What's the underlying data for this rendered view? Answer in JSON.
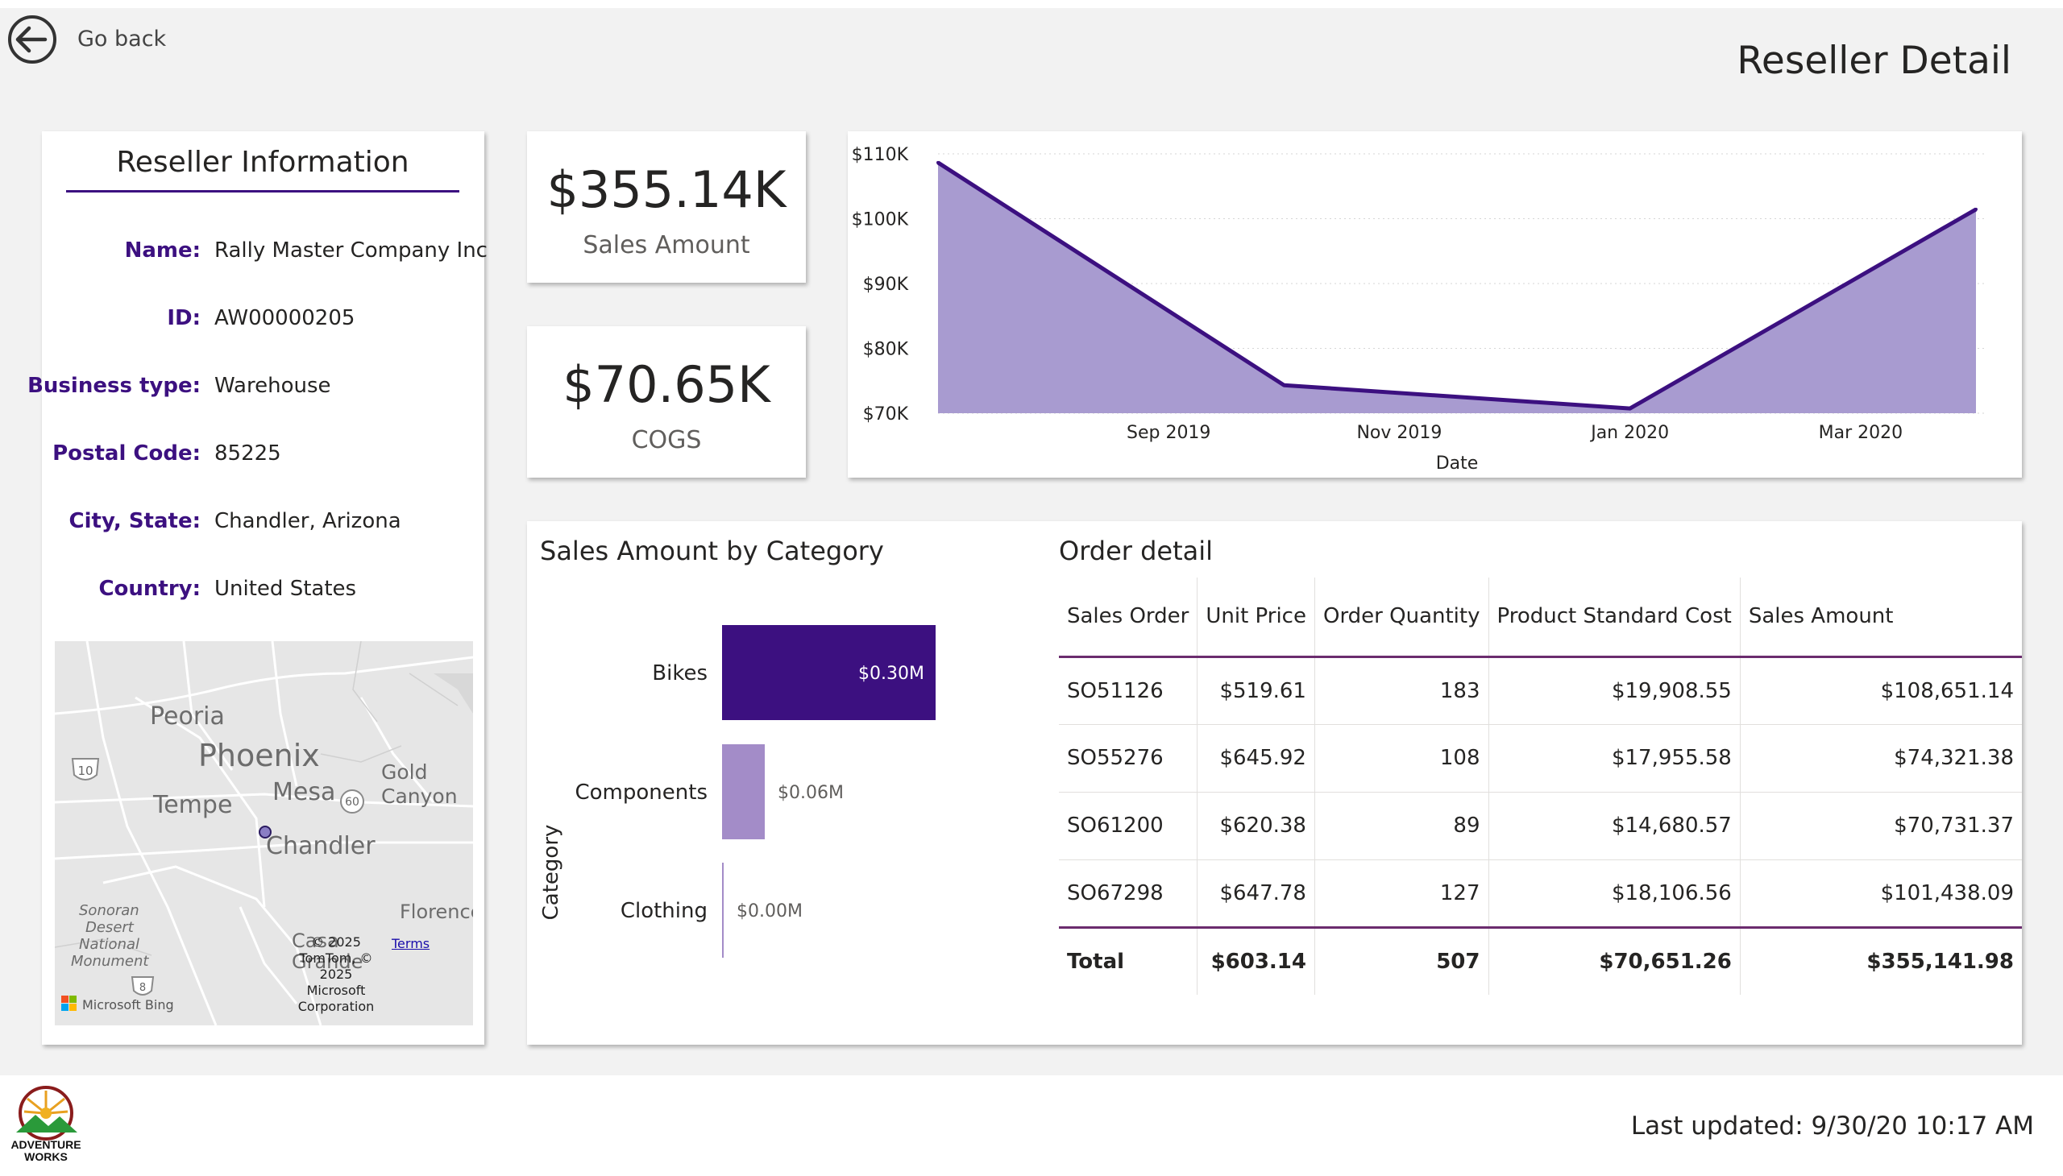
{
  "header": {
    "back_label": "Go back",
    "page_title": "Reseller Detail"
  },
  "reseller": {
    "title": "Reseller Information",
    "fields": [
      {
        "label": "Name:",
        "value": "Rally Master Company Inc"
      },
      {
        "label": "ID:",
        "value": "AW00000205"
      },
      {
        "label": "Business type:",
        "value": "Warehouse"
      },
      {
        "label": "Postal Code:",
        "value": "85225"
      },
      {
        "label": "City, State:",
        "value": "Chandler, Arizona"
      },
      {
        "label": "Country:",
        "value": "United States"
      }
    ],
    "map": {
      "places": [
        "Peoria",
        "Phoenix",
        "Gold",
        "Canyon",
        "Tempe",
        "Mesa",
        "Chandler",
        "Florence",
        "Casa",
        "Grande",
        "Sonoran",
        "Desert",
        "National",
        "Monument"
      ],
      "shields": [
        "10",
        "60",
        "8"
      ],
      "provider": "Microsoft Bing",
      "copyright": "© 2025 TomTom, © 2025 Microsoft Corporation",
      "copyright_lines": [
        "© 2025",
        "TomTom, ©",
        "2025",
        "Microsoft",
        "Corporation"
      ],
      "terms_link": "Terms"
    }
  },
  "kpis": [
    {
      "value": "$355.14K",
      "label": "Sales Amount"
    },
    {
      "value": "$70.65K",
      "label": "COGS"
    }
  ],
  "chart_data": [
    {
      "type": "area",
      "title": "",
      "xlabel": "Date",
      "ylabel": "",
      "x": [
        "2019-07",
        "2019-10",
        "2020-01",
        "2020-04"
      ],
      "x_tick_labels": [
        "Sep 2019",
        "Nov 2019",
        "Jan 2020",
        "Mar 2020"
      ],
      "y_tick_labels": [
        "$70K",
        "$80K",
        "$90K",
        "$100K",
        "$110K"
      ],
      "ylim": [
        70000,
        110000
      ],
      "series": [
        {
          "values": [
            108651.14,
            74321.38,
            70731.37,
            101438.09
          ]
        }
      ],
      "grid": true,
      "colors": {
        "line": "#3c1080",
        "fill": "#a89bd0"
      }
    },
    {
      "type": "bar",
      "title": "Sales Amount by Category",
      "xlabel": "",
      "ylabel": "Category",
      "categories": [
        "Bikes",
        "Components",
        "Clothing"
      ],
      "values": [
        0.3,
        0.06,
        0.0
      ],
      "data_labels": [
        "$0.30M",
        "$0.06M",
        "$0.00M"
      ],
      "colors": [
        "#3c1080",
        "#a38cc8",
        "#a38cc8"
      ]
    }
  ],
  "order_detail": {
    "title": "Order detail",
    "columns": [
      "Sales Order",
      "Unit Price",
      "Order Quantity",
      "Product Standard Cost",
      "Sales Amount"
    ],
    "rows": [
      [
        "SO51126",
        "$519.61",
        "183",
        "$19,908.55",
        "$108,651.14"
      ],
      [
        "SO55276",
        "$645.92",
        "108",
        "$17,955.58",
        "$74,321.38"
      ],
      [
        "SO61200",
        "$620.38",
        "89",
        "$14,680.57",
        "$70,731.37"
      ],
      [
        "SO67298",
        "$647.78",
        "127",
        "$18,106.56",
        "$101,438.09"
      ]
    ],
    "total": [
      "Total",
      "$603.14",
      "507",
      "$70,651.26",
      "$355,141.98"
    ]
  },
  "footer": {
    "logo_text": [
      "ADVENTURE",
      "WORKS"
    ],
    "last_updated": "Last updated: 9/30/20 10:17 AM"
  },
  "icons": {
    "back": "back-arrow-icon",
    "map_pin": "location-pin-icon",
    "logo": "adventure-works-logo"
  },
  "colors": {
    "accent": "#3c1080",
    "fill": "#a89bd0",
    "bar_light": "#a38cc8",
    "table_rule": "#6b2c6e",
    "canvas": "#f2f2f2"
  }
}
